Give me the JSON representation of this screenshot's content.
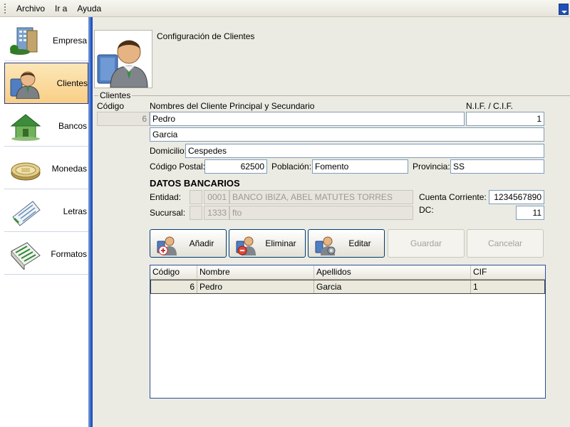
{
  "menu": {
    "items": [
      "Archivo",
      "Ir a",
      "Ayuda"
    ]
  },
  "sidebar": {
    "items": [
      {
        "label": "Empresa",
        "icon": "building-icon"
      },
      {
        "label": "Clientes",
        "icon": "client-person-icon"
      },
      {
        "label": "Bancos",
        "icon": "bank-house-icon"
      },
      {
        "label": "Monedas",
        "icon": "coins-icon"
      },
      {
        "label": "Letras",
        "icon": "letter-document-icon"
      },
      {
        "label": "Formatos",
        "icon": "formats-sheet-icon"
      }
    ],
    "active": "Clientes"
  },
  "page": {
    "title": "Configuración de Clientes"
  },
  "form": {
    "group_title": "Clientes",
    "codigo_label": "Código",
    "codigo_value": "6",
    "nombres_label": "Nombres del Cliente Principal y Secundario",
    "nombre_value": "Pedro",
    "apellidos_value": "Garcia",
    "nif_label": "N.I.F. / C.I.F.",
    "nif_value": "1",
    "domicilio_label": "Domicilio:",
    "domicilio_value": "Cespedes",
    "cp_label": "Código Postal:",
    "cp_value": "62500",
    "poblacion_label": "Población:",
    "poblacion_value": "Fomento",
    "provincia_label": "Provincia:",
    "provincia_value": "SS",
    "banco_heading": "DATOS BANCARIOS",
    "entidad_label": "Entidad:",
    "entidad_code": "0001",
    "entidad_name": "BANCO IBIZA, ABEL MATUTES TORRES",
    "sucursal_label": "Sucursal:",
    "sucursal_code": "1333",
    "sucursal_name": "fto",
    "cuenta_label": "Cuenta Corriente:",
    "cuenta_value": "1234567890",
    "dc_label": "DC:",
    "dc_value": "11"
  },
  "buttons": {
    "add": "Añadir",
    "delete": "Eliminar",
    "edit": "Editar",
    "save": "Guardar",
    "cancel": "Cancelar"
  },
  "grid": {
    "columns": [
      "Código",
      "Nombre",
      "Apellidos",
      "CIF"
    ],
    "rows": [
      {
        "codigo": "6",
        "nombre": "Pedro",
        "apellidos": "Garcia",
        "cif": "1"
      }
    ]
  }
}
